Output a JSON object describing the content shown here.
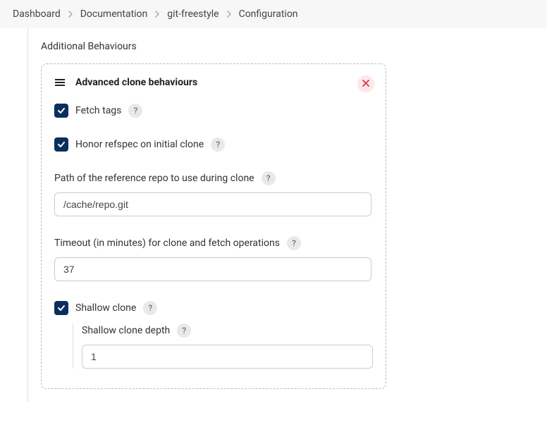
{
  "breadcrumb": {
    "items": [
      "Dashboard",
      "Documentation",
      "git-freestyle",
      "Configuration"
    ]
  },
  "section": {
    "title": "Additional Behaviours"
  },
  "card": {
    "title": "Advanced clone behaviours",
    "help_char": "?",
    "fields": {
      "fetch_tags": {
        "label": "Fetch tags",
        "checked": true
      },
      "honor_refspec": {
        "label": "Honor refspec on initial clone",
        "checked": true
      },
      "reference_repo": {
        "label": "Path of the reference repo to use during clone",
        "value": "/cache/repo.git"
      },
      "timeout": {
        "label": "Timeout (in minutes) for clone and fetch operations",
        "value": "37"
      },
      "shallow_clone": {
        "label": "Shallow clone",
        "checked": true,
        "depth": {
          "label": "Shallow clone depth",
          "value": "1"
        }
      }
    }
  }
}
